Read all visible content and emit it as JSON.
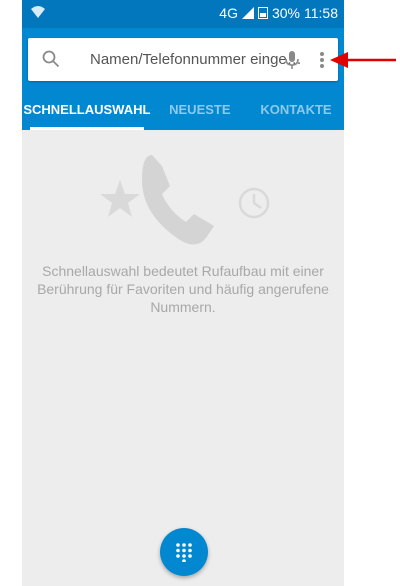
{
  "status_bar": {
    "network": "4G",
    "battery": "30%",
    "time": "11:58"
  },
  "search": {
    "placeholder": "Namen/Telefonnummer einge…"
  },
  "tabs": [
    {
      "label": "SCHNELLAUSWAHL",
      "active": true
    },
    {
      "label": "NEUESTE",
      "active": false
    },
    {
      "label": "KONTAKTE",
      "active": false
    }
  ],
  "empty_state": {
    "text": "Schnellauswahl bedeutet Rufaufbau mit einer Berührung für Favoriten und häufig angerufene Nummern."
  },
  "colors": {
    "status_bar": "#0277bd",
    "app_bar": "#0288d1",
    "background": "#ededed",
    "annotation_arrow": "#e00000"
  },
  "icons": {
    "wifi": "wifi-icon",
    "signal": "signal-icon",
    "battery": "battery-icon",
    "search": "search-icon",
    "mic": "mic-icon",
    "more": "more-vert-icon",
    "star": "star-icon",
    "phone": "phone-icon",
    "clock": "clock-icon",
    "dialpad": "dialpad-icon"
  }
}
